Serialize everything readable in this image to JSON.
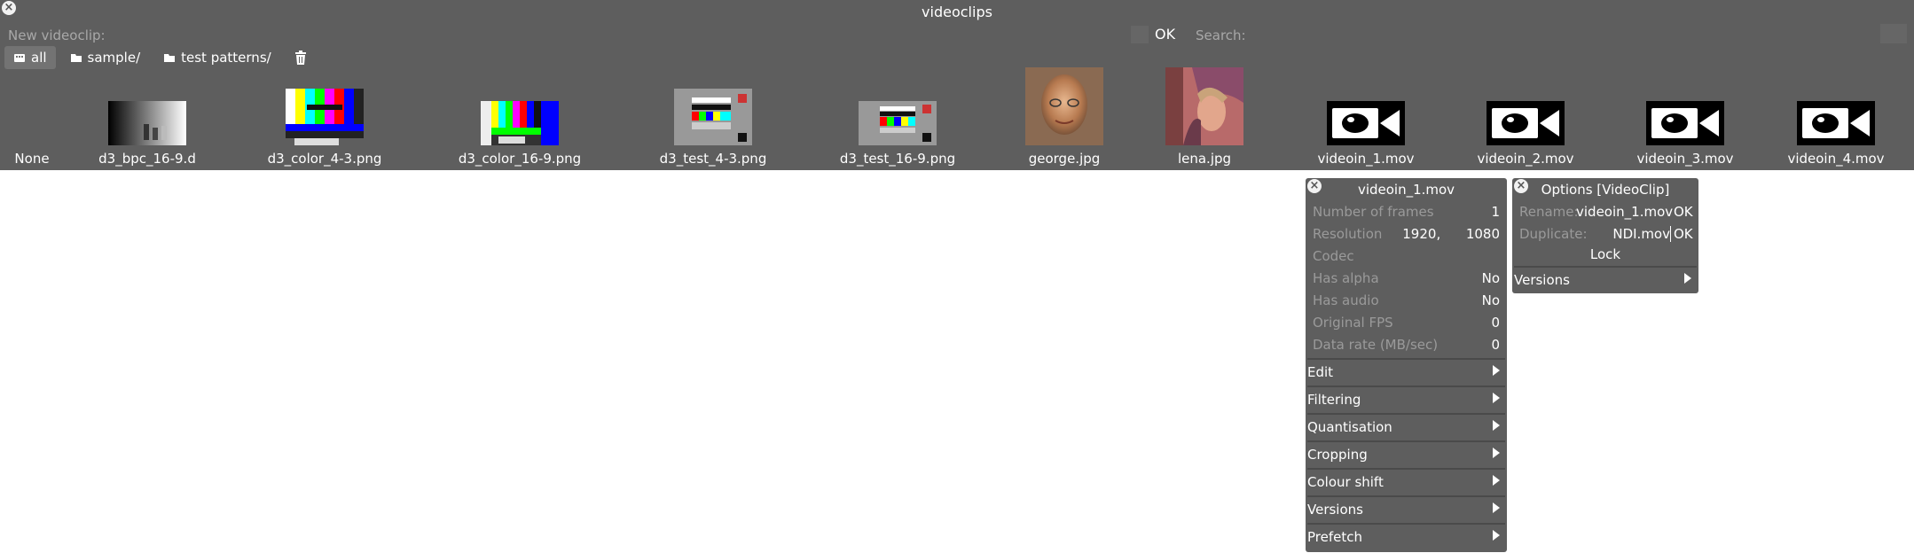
{
  "window": {
    "title": "videoclips"
  },
  "toolbar": {
    "new_label": "New videoclip:",
    "ok_label": "OK",
    "search_label": "Search:"
  },
  "filters": [
    {
      "label": "all",
      "icon": "storage-icon",
      "selected": true
    },
    {
      "label": "sample/",
      "icon": "folder-icon",
      "selected": false
    },
    {
      "label": "test patterns/",
      "icon": "folder-icon",
      "selected": false
    }
  ],
  "clips": [
    {
      "name": "None",
      "thumb": "none"
    },
    {
      "name": "d3_bpc_16-9.d",
      "thumb": "gradient"
    },
    {
      "name": "d3_color_4-3.png",
      "thumb": "bars43"
    },
    {
      "name": "d3_color_16-9.png",
      "thumb": "bars169"
    },
    {
      "name": "d3_test_4-3.png",
      "thumb": "test43"
    },
    {
      "name": "d3_test_16-9.png",
      "thumb": "test169"
    },
    {
      "name": "george.jpg",
      "thumb": "photo-george"
    },
    {
      "name": "lena.jpg",
      "thumb": "photo-lena"
    },
    {
      "name": "videoin_1.mov",
      "thumb": "camera"
    },
    {
      "name": "videoin_2.mov",
      "thumb": "camera"
    },
    {
      "name": "videoin_3.mov",
      "thumb": "camera"
    },
    {
      "name": "videoin_4.mov",
      "thumb": "camera"
    }
  ],
  "info_panel": {
    "title": "videoin_1.mov",
    "rows": [
      {
        "key": "Number of frames",
        "value": "1"
      },
      {
        "key": "Resolution",
        "value": "1920,      1080"
      },
      {
        "key": "Codec",
        "value": ""
      },
      {
        "key": "Has alpha",
        "value": "No"
      },
      {
        "key": "Has audio",
        "value": "No"
      },
      {
        "key": "Original FPS",
        "value": "0"
      },
      {
        "key": "Data rate (MB/sec)",
        "value": "0"
      }
    ],
    "menus": [
      "Edit",
      "Filtering",
      "Quantisation",
      "Cropping",
      "Colour shift",
      "Versions",
      "Prefetch"
    ]
  },
  "options_panel": {
    "title": "Options [VideoClip]",
    "rename_label": "Rename:",
    "rename_value": "videoin_1.mov",
    "duplicate_label": "Duplicate:",
    "duplicate_value": "NDI.mov",
    "ok_label": "OK",
    "lock_label": "Lock",
    "versions_label": "Versions"
  },
  "colors": {
    "panel": "#5e5e5e",
    "dim_text": "#a8a8a8",
    "text": "#ffffff"
  }
}
